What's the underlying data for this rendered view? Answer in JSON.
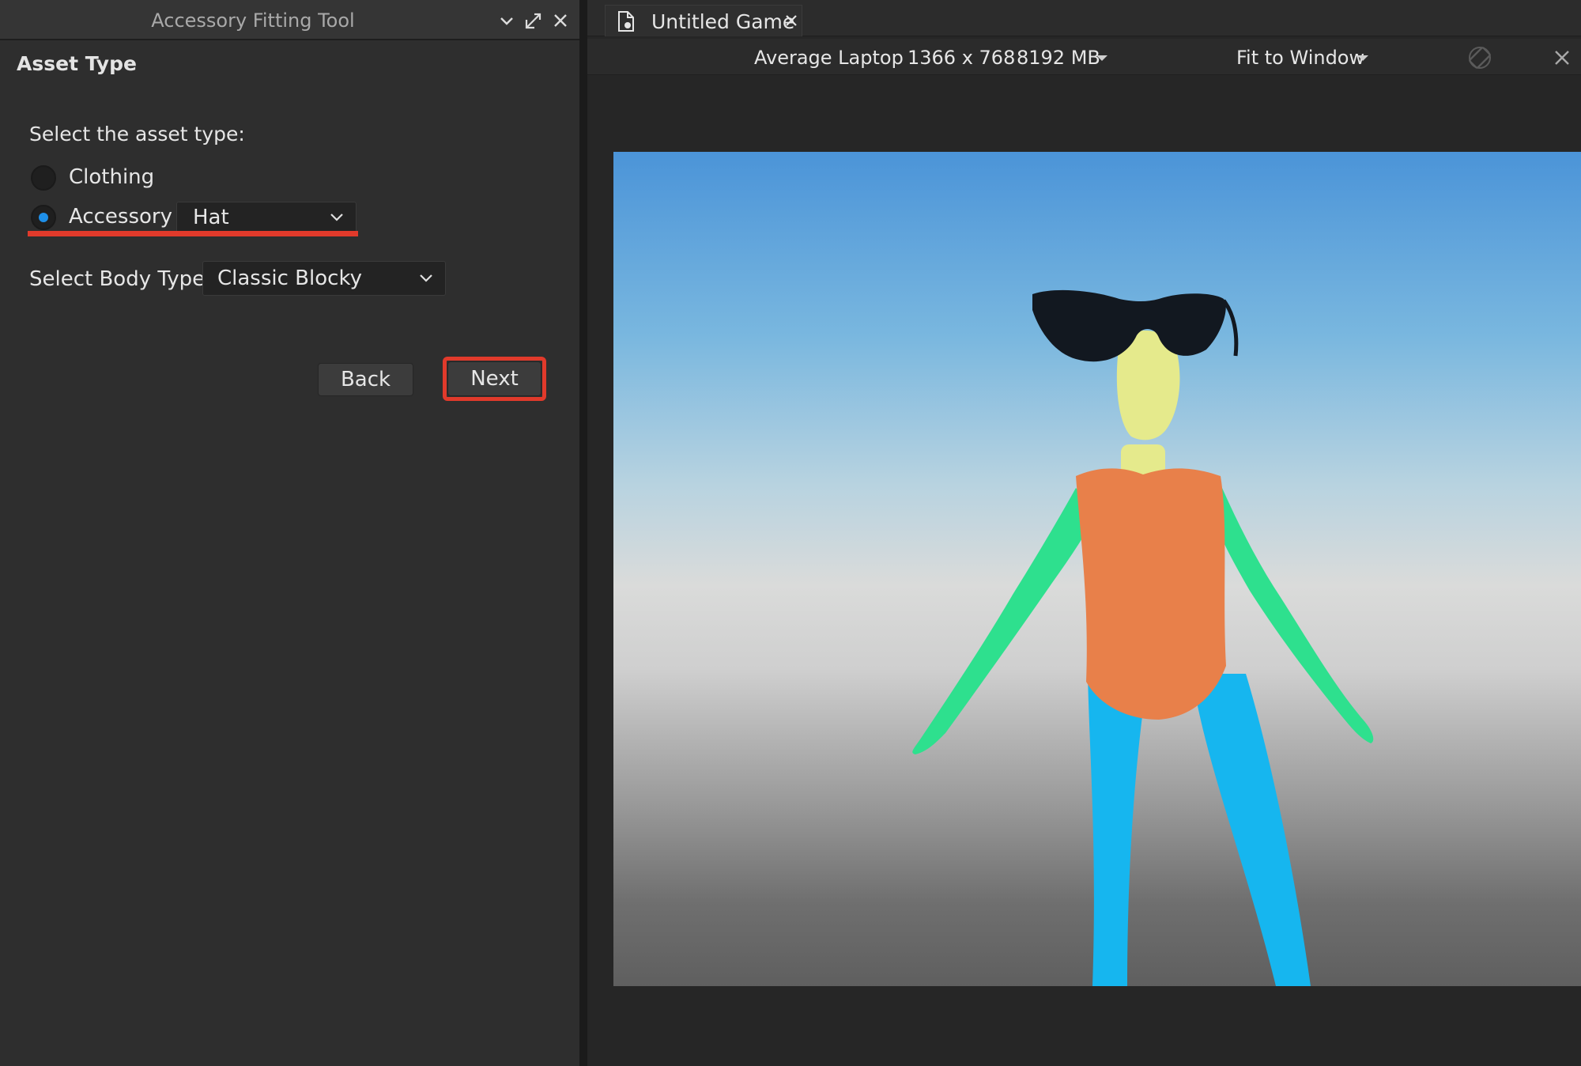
{
  "panel": {
    "title": "Accessory Fitting Tool",
    "section_heading": "Asset Type",
    "asset_type_prompt": "Select the asset type:",
    "options": {
      "clothing": {
        "label": "Clothing",
        "selected": false
      },
      "accessory": {
        "label": "Accessory",
        "selected": true
      }
    },
    "accessory_dropdown_value": "Hat",
    "body_type_label": "Select Body Type:",
    "body_type_value": "Classic Blocky",
    "back_label": "Back",
    "next_label": "Next"
  },
  "tabs": [
    {
      "label": "Untitled Game"
    }
  ],
  "device_bar": {
    "device": "Average Laptop",
    "resolution": "1366 x 768",
    "memory": "8192 MB",
    "scale": "Fit to Window"
  },
  "icons": {
    "collapse": "chevron-down-icon",
    "undock": "undock-icon",
    "close": "close-icon",
    "document": "document-icon",
    "rotate": "rotate-disabled-icon"
  },
  "colors": {
    "highlight": "#e13a2b",
    "radio_selected": "#1e8fe8",
    "torso": "#e8804a",
    "arms": "#2ee08e",
    "legs": "#16b6ef",
    "head": "#e5ea8c"
  }
}
